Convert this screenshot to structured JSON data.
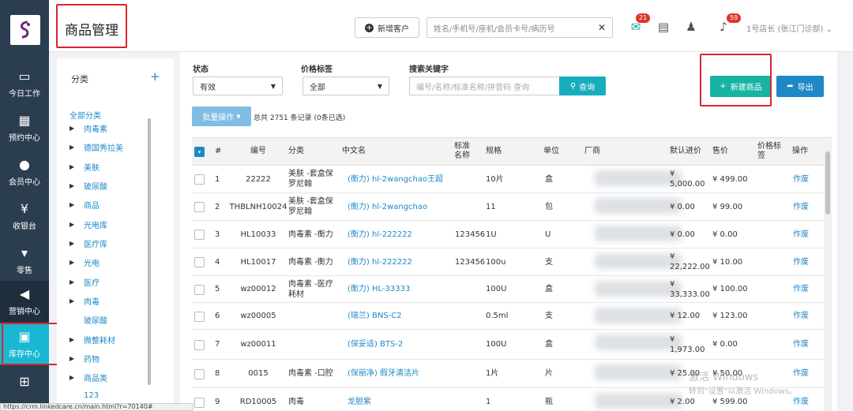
{
  "nav": {
    "items": [
      {
        "label": "今日工作",
        "icon": "laptop-icon"
      },
      {
        "label": "预约中心",
        "icon": "calendar-icon"
      },
      {
        "label": "会员中心",
        "icon": "users-icon"
      },
      {
        "label": "收银台",
        "icon": "yen-icon"
      },
      {
        "label": "零售",
        "icon": "cart-icon"
      },
      {
        "label": "营销中心",
        "icon": "megaphone-icon"
      },
      {
        "label": "库存中心",
        "icon": "grid-icon"
      },
      {
        "label": "",
        "icon": "medkit-icon"
      }
    ]
  },
  "header": {
    "title": "商品管理",
    "new_customer": "新增客户",
    "search_placeholder": "姓名/手机号/座机/会员卡号/病历号",
    "badge_chat": "21",
    "badge_bell": "59",
    "user": "1号店长 (张江门诊部)"
  },
  "categories": {
    "head": "分类",
    "add": "+",
    "all": "全部分类",
    "items": [
      "肉毒素",
      "德国秀拉美",
      "美肤",
      "玻尿酸",
      "商品",
      "光电库",
      "医疗库",
      "光电",
      "医疗",
      "肉毒",
      "玻尿酸",
      "微整耗材",
      "药物",
      "商品类",
      "123"
    ]
  },
  "filters": {
    "status_label": "状态",
    "status_value": "有效",
    "price_tag_label": "价格标签",
    "price_tag_value": "全部",
    "keyword_label": "搜索关键字",
    "keyword_placeholder": "编号/名称/标准名称/拼音码 查询",
    "query": "查询",
    "new_product": "新建商品",
    "export": "导出",
    "batch": "批量操作",
    "total": "总共 2751 条记录 (0条已选)"
  },
  "table": {
    "columns": [
      "#",
      "编号",
      "分类",
      "中文名",
      "标准名称",
      "规格",
      "单位",
      "厂商",
      "默认进价",
      "售价",
      "价格标签",
      "操作"
    ],
    "rows": [
      {
        "n": "1",
        "code": "22222",
        "cat": "美肤 -套盒保罗尼翰",
        "name": "(衡力) hl-2wangchao王超",
        "std": "",
        "spec": "10片",
        "unit": "盒",
        "cost": "¥ 5,000.00",
        "price": "¥ 499.00",
        "action": "作废"
      },
      {
        "n": "2",
        "code": "THBLNH10024",
        "cat": "美肤 -套盒保罗尼翰",
        "name": "(衡力) hl-2wangchao",
        "std": "",
        "spec": "11",
        "unit": "包",
        "cost": "¥ 0.00",
        "price": "¥ 99.00",
        "action": "作废"
      },
      {
        "n": "3",
        "code": "HL10033",
        "cat": "肉毒素 -衡力",
        "name": "(衡力) hl-222222",
        "std": "123456",
        "spec": "1U",
        "unit": "U",
        "cost": "¥ 0.00",
        "price": "¥ 0.00",
        "action": "作废"
      },
      {
        "n": "4",
        "code": "HL10017",
        "cat": "肉毒素 -衡力",
        "name": "(衡力) hl-222222",
        "std": "123456",
        "spec": "100u",
        "unit": "支",
        "cost": "¥ 22,222.00",
        "price": "¥ 10.00",
        "action": "作废"
      },
      {
        "n": "5",
        "code": "wz00012",
        "cat": "肉毒素 -医疗耗材",
        "name": "(衡力) HL-33333",
        "std": "",
        "spec": "100U",
        "unit": "盒",
        "cost": "¥ 33,333.00",
        "price": "¥ 100.00",
        "action": "作废"
      },
      {
        "n": "6",
        "code": "wz00005",
        "cat": "",
        "name": "(瑞兰) BNS-C2",
        "std": "",
        "spec": "0.5ml",
        "unit": "支",
        "cost": "¥ 12.00",
        "price": "¥ 123.00",
        "action": "作废"
      },
      {
        "n": "7",
        "code": "wz00011",
        "cat": "",
        "name": "(保妥适) BTS-2",
        "std": "",
        "spec": "100U",
        "unit": "盒",
        "cost": "¥ 1,973.00",
        "price": "¥ 0.00",
        "action": "作废"
      },
      {
        "n": "8",
        "code": "0015",
        "cat": "肉毒素 -口腔",
        "name": "(保丽净) 假牙清洁片",
        "std": "",
        "spec": "1片",
        "unit": "片",
        "cost": "¥ 25.00",
        "price": "¥ 50.00",
        "action": "作废"
      },
      {
        "n": "9",
        "code": "RD10005",
        "cat": "肉毒",
        "name": "龙胆紫",
        "std": "",
        "spec": "1",
        "unit": "瓶",
        "cost": "¥ 2.00",
        "price": "¥ 599.00",
        "action": "作废"
      }
    ]
  },
  "watermark": {
    "line1": "激活 Windows",
    "line2": "转到\"设置\"以激活 Windows。"
  },
  "status_url": "https://crm.linkedcare.cn/main.html?r=70140#"
}
